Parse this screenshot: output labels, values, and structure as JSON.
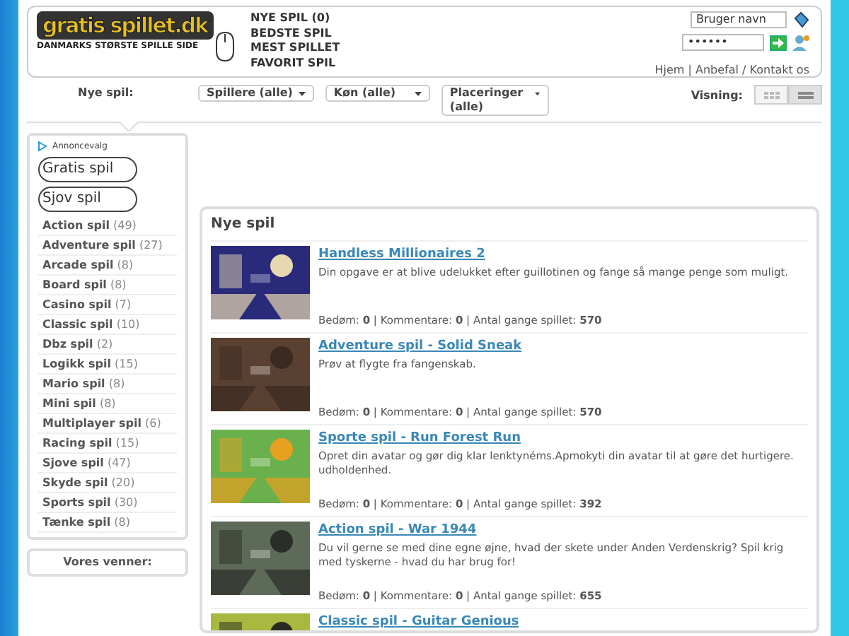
{
  "logo": {
    "title": "gratis spillet.dk",
    "tagline": "DANMARKS STØRSTE SPILLE SIDE"
  },
  "top_menu": [
    "NYE SPIL (0)",
    "BEDSTE SPIL",
    "MEST SPILLET",
    "FAVORIT SPIL"
  ],
  "login": {
    "username": "Bruger navn",
    "password": "••••••"
  },
  "top_links": [
    {
      "label": "Hjem",
      "sep": " | "
    },
    {
      "label": "Anbefal",
      "sep": " / "
    },
    {
      "label": "Kontakt os"
    }
  ],
  "filter_bar": {
    "label": "Nye spil:",
    "dropdowns": [
      "Spillere (alle)",
      "Køn (alle)",
      "Placeringer (alle)"
    ],
    "view_label": "Visning:",
    "views": [
      {
        "kind": "grid",
        "selected": false
      },
      {
        "kind": "list",
        "selected": true
      }
    ]
  },
  "sidebar": {
    "ad_label": "Annoncevalg",
    "ad_buttons": [
      "Gratis spil",
      "Sjov spil"
    ],
    "categories": [
      {
        "name": "Action spil",
        "count": "(49)"
      },
      {
        "name": "Adventure spil",
        "count": "(27)"
      },
      {
        "name": "Arcade spil",
        "count": "(8)"
      },
      {
        "name": "Board spil",
        "count": "(8)"
      },
      {
        "name": "Casino spil",
        "count": "(7)"
      },
      {
        "name": "Classic spil",
        "count": "(10)"
      },
      {
        "name": "Dbz spil",
        "count": "(2)"
      },
      {
        "name": "Logikk spil",
        "count": "(15)"
      },
      {
        "name": "Mario spil",
        "count": "(8)"
      },
      {
        "name": "Mini spil",
        "count": "(8)"
      },
      {
        "name": "Multiplayer spil",
        "count": "(6)"
      },
      {
        "name": "Racing spil",
        "count": "(15)"
      },
      {
        "name": "Sjove spil",
        "count": "(47)"
      },
      {
        "name": "Skyde spil",
        "count": "(20)"
      },
      {
        "name": "Sports spil",
        "count": "(30)"
      },
      {
        "name": "Tænke spil",
        "count": "(8)"
      }
    ],
    "friends_title": "Vores venner:"
  },
  "main": {
    "title": "Nye spil",
    "games": [
      {
        "title": "Handless Millionaires 2",
        "description": "Din opgave er at blive udelukket efter guillotinen og fange så mange penge som muligt.",
        "stats": "Bedøm: **0** | Kommentare: **0** | Antal gange spillet: **570**"
      },
      {
        "title": "Adventure spil - Solid Sneak",
        "description": "Prøv at flygte fra fangenskab.",
        "stats": "Bedøm: **0** | Kommentare: **0** | Antal gange spillet: **570**"
      },
      {
        "title": "Sporte spil - Run Forest Run",
        "description": "Opret din avatar og gør dig klar lenktynéms.Apmokyti din avatar til at gøre det hurtigere. udholdenhed.",
        "stats": "Bedøm: **0** | Kommentare: **0** | Antal gange spillet: **392**"
      },
      {
        "title": "Action spil - War 1944",
        "description": "Du vil gerne se med dine egne øjne, hvad der skete under Anden Verdenskrig? Spil krig med tyskerne - hvad du har brug for!",
        "stats": "Bedøm: **0** | Kommentare: **0** | Antal gange spillet: **655**"
      },
      {
        "title": "Classic spil - Guitar Genious"
      }
    ]
  }
}
